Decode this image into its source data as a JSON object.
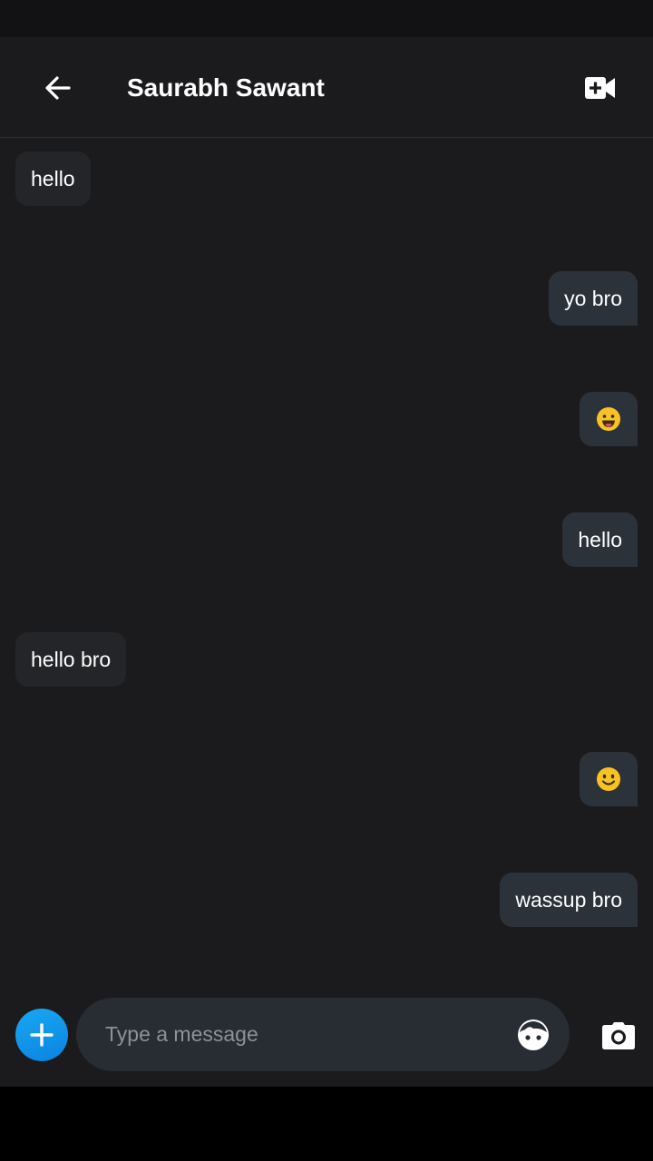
{
  "header": {
    "title": "Saurabh Sawant",
    "back_icon": "arrow-left-icon",
    "video_icon": "video-call-icon"
  },
  "messages": [
    {
      "direction": "incoming",
      "text": "hello"
    },
    {
      "direction": "outgoing",
      "text": "yo bro"
    },
    {
      "direction": "outgoing",
      "emoji": "grinning-face-emoji"
    },
    {
      "direction": "outgoing",
      "text": "hello"
    },
    {
      "direction": "incoming",
      "text": "hello bro"
    },
    {
      "direction": "outgoing",
      "emoji": "smiling-face-emoji"
    },
    {
      "direction": "outgoing",
      "text": "wassup bro"
    }
  ],
  "composer": {
    "placeholder": "Type a message",
    "value": "",
    "add_icon": "plus-icon",
    "sticker_icon": "sticker-face-icon",
    "camera_icon": "camera-icon"
  },
  "colors": {
    "background": "#1b1b1e",
    "incoming_bubble": "#232529",
    "outgoing_bubble": "#2c3239",
    "accent": "#0b9aeb",
    "emoji": "#f7c324"
  }
}
